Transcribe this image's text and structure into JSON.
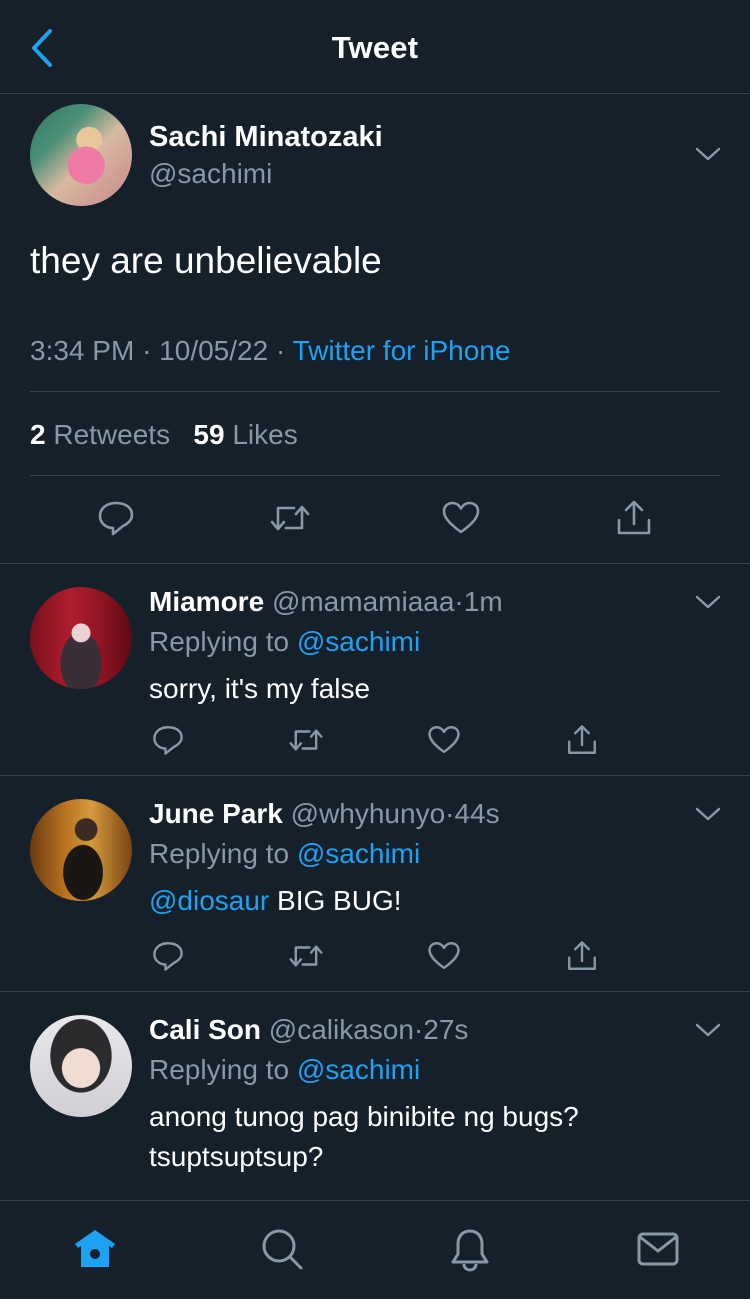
{
  "header": {
    "title": "Tweet"
  },
  "main_tweet": {
    "name": "Sachi Minatozaki",
    "handle": "@sachimi",
    "text": "they are unbelievable",
    "time": "3:34 PM",
    "date": "10/05/22",
    "source": "Twitter for iPhone",
    "retweets": "2",
    "retweets_label": "Retweets",
    "likes": "59",
    "likes_label": "Likes"
  },
  "replies": [
    {
      "name": "Miamore",
      "handle": "@mamamiaaa",
      "time": "1m",
      "replying_label": "Replying to",
      "replying_to": "@sachimi",
      "mention": "",
      "text": "sorry, it's my false"
    },
    {
      "name": "June Park",
      "handle": "@whyhunyo",
      "time": "44s",
      "replying_label": "Replying to",
      "replying_to": "@sachimi",
      "mention": "@diosaur",
      "text": " BIG BUG!"
    },
    {
      "name": "Cali Son",
      "handle": "@calikason",
      "time": "27s",
      "replying_label": "Replying to",
      "replying_to": "@sachimi",
      "mention": "",
      "text": "anong tunog pag binibite ng bugs? tsuptsuptsup?"
    }
  ],
  "separator": "·",
  "tabbar": {
    "items": [
      "home-icon",
      "search-icon",
      "bell-icon",
      "mail-icon"
    ],
    "active": "home-icon"
  },
  "colors": {
    "background": "#15202b",
    "accent": "#1da1f2",
    "secondary_text": "#8899a6",
    "divider": "#38444d"
  }
}
